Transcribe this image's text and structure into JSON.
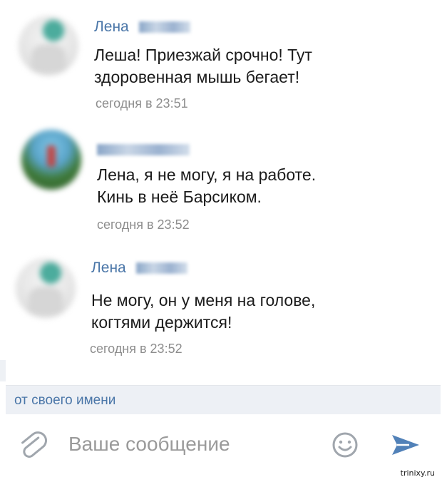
{
  "messages": [
    {
      "author": "Лена",
      "text": "Леша! Приезжай срочно! Тут\nздоровенная мышь бегает!",
      "time": "сегодня в 23:51"
    },
    {
      "author": "",
      "text": "Лена, я не могу, я на работе.\nКинь в неё Барсиком.",
      "time": "сегодня в 23:52"
    },
    {
      "author": "Лена",
      "text": "Не могу, он у меня на голове,\nкогтями держится!",
      "time": "сегодня в 23:52"
    }
  ],
  "sender_bar": {
    "label": "от своего имени"
  },
  "composer": {
    "placeholder": "Ваше сообщение"
  },
  "watermark": "trinixy.ru",
  "colors": {
    "link": "#4a76a8",
    "muted": "#8d8d8d",
    "bar": "#edf0f5"
  },
  "icons": [
    "attach-icon",
    "emoji-icon",
    "send-icon"
  ]
}
